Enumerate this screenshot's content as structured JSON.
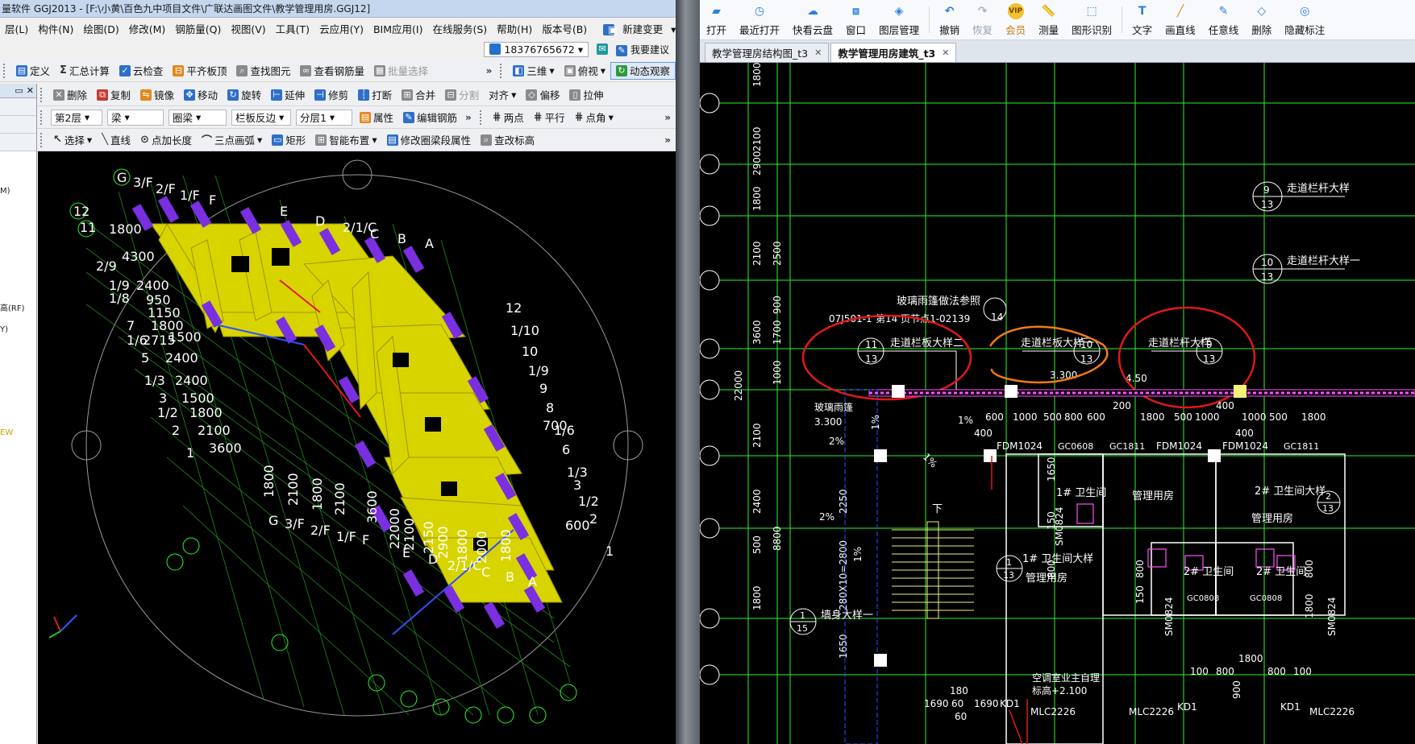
{
  "left_window": {
    "title": "量软件 GGJ2013 - [F:\\小黄\\百色九中项目文件\\广联达画图文件\\教学管理用房.GGJ12]",
    "menu": [
      "层(L)",
      "构件(N)",
      "绘图(D)",
      "修改(M)",
      "钢筋量(Q)",
      "视图(V)",
      "工具(T)",
      "云应用(Y)",
      "BIM应用(I)",
      "在线服务(S)",
      "帮助(H)",
      "版本号(B)",
      "新建变更"
    ],
    "phone": "18376765672",
    "suggest": "我要建议",
    "toolbar1": {
      "items": [
        "定义",
        "汇总计算",
        "云检查",
        "平齐板顶",
        "查找图元",
        "查看钢筋量",
        "批量选择"
      ],
      "view_items": [
        "三维",
        "俯视",
        "动态观察"
      ]
    },
    "toolbar2": [
      "删除",
      "复制",
      "镜像",
      "移动",
      "旋转",
      "延伸",
      "修剪",
      "打断",
      "合并",
      "分割",
      "对齐",
      "偏移",
      "拉伸"
    ],
    "toolbar3": {
      "floor": "第2层",
      "type": "梁",
      "subtype": "圈梁",
      "element": "栏板反边",
      "layer": "分层1",
      "attr": "属性",
      "edit_rebar": "编辑钢筋",
      "snap_items": [
        "两点",
        "平行",
        "点角"
      ]
    },
    "toolbar4": [
      "选择",
      "直线",
      "点加长度",
      "三点画弧",
      "矩形",
      "智能布置",
      "修改圈梁段属性",
      "查改标高"
    ],
    "side_labels": [
      "M)",
      "高(RF)",
      "Y)",
      "EW"
    ],
    "axis_labels_left": [
      "G",
      "3/F",
      "2/F",
      "1/F",
      "F",
      "12",
      "11",
      "1800",
      "4300",
      "2/9",
      "1/9",
      "1/8",
      "2400",
      "950",
      "1150",
      "7",
      "1800",
      "1/6",
      "2715",
      "1500",
      "5",
      "2400",
      "1/3",
      "2400",
      "3",
      "1500",
      "1/2",
      "1800",
      "2",
      "2100",
      "1",
      "3600"
    ],
    "axis_labels_top": [
      "E",
      "D",
      "2/1/C",
      "C",
      "B",
      "A"
    ],
    "axis_labels_right": [
      "12",
      "1/10",
      "10",
      "1/9",
      "9",
      "8",
      "700",
      "1/6",
      "6",
      "1/3",
      "3",
      "1/2",
      "2",
      "1",
      "600"
    ],
    "axis_labels_bottom": [
      "G",
      "3/F",
      "2/F",
      "1/F",
      "F",
      "1800",
      "2100",
      "1800",
      "2100",
      "3600",
      "22000",
      "2100",
      "2150",
      "2900",
      "1800",
      "2000",
      "1800",
      "E",
      "D",
      "2/1/C",
      "C",
      "B",
      "A"
    ]
  },
  "right_window": {
    "ribbon": [
      "打开",
      "最近打开",
      "快看云盘",
      "窗口",
      "图层管理",
      "撤销",
      "恢复",
      "会员",
      "测量",
      "图形识别",
      "文字",
      "画直线",
      "任意线",
      "删除",
      "隐藏标注"
    ],
    "vip_badge": "VIP",
    "tabs": [
      {
        "label": "教学管理房结构图_t3",
        "active": false
      },
      {
        "label": "教学管理用房建筑_t3",
        "active": true
      }
    ],
    "cad_texts": {
      "left_dims": [
        "1800",
        "2100",
        "2900",
        "1800",
        "2500",
        "2100",
        "900",
        "3600",
        "1700",
        "1000",
        "22000",
        "2100",
        "2400",
        "2250",
        "500",
        "8800",
        "1800",
        "1650",
        "280X10=2800"
      ],
      "canopy_note": "玻璃雨篷做法参照",
      "canopy_ref": "07J501-1",
      "canopy_page": "第14 页节点1-02139",
      "canopy_num": "14",
      "detail1_title": "走道栏板大样二",
      "detail1_num": "11",
      "detail1_sheet": "13",
      "detail2_title": "走道栏板大样一",
      "detail2_num": "10",
      "detail2_sheet": "13",
      "detail3_title": "走道栏杆大样",
      "detail3_num": "9",
      "detail3_sheet": "13",
      "top_detail1_title": "走道栏杆大样",
      "top_detail1_num": "9",
      "top_detail1_sheet": "13",
      "top_detail2_title": "走道栏杆大样一",
      "top_detail2_num": "10",
      "top_detail2_sheet": "13",
      "elev1": "3.300",
      "elev2": "4.50",
      "elev3": "3.300",
      "canopy": "玻璃雨篷",
      "slope1": "1%",
      "slope2": "2%",
      "slope3": "1%",
      "slope4": "2%",
      "slope5": "1%",
      "slope6": "1%",
      "dims_row": [
        "600",
        "1000",
        "500",
        "800",
        "600",
        "200",
        "1800",
        "500",
        "1000",
        "400",
        "1000",
        "500",
        "1800"
      ],
      "dims_400": [
        "400",
        "400"
      ],
      "doors": [
        "FDM1024",
        "GC0608",
        "GC1811",
        "FDM1024",
        "FDM1024",
        "GC1811"
      ],
      "room1": "1# 卫生间",
      "room2": "管理用房",
      "room3": "2# 卫生间大样",
      "room4": "管理用房",
      "room5": "1# 卫生间大样",
      "room6": "管理用房",
      "room7": "2# 卫生间",
      "room8": "2# 卫生间",
      "detail_2_13_a": "2",
      "detail_2_13_b": "13",
      "detail_1_13_a": "1",
      "detail_1_13_b": "13",
      "wall_detail": "墙身大样一",
      "wall_detail_num": "1",
      "wall_detail_sheet": "15",
      "ac_note": "空调室业主自理",
      "ac_elev": "标高+2.100",
      "stair_down": "下",
      "mlc1": "MLC2226",
      "mlc2": "MLC2226",
      "mlc3": "MLC2226",
      "kd1": "KD1",
      "kd2": "KD1",
      "kd3": "KD1",
      "sm1": "SM0824",
      "sm2": "SM0824",
      "sm3": "SM0824",
      "gc0808a": "GC0808",
      "gc0808b": "GC0808",
      "bottom_dims": [
        "180",
        "1690",
        "60",
        "1690",
        "60"
      ],
      "bath_dims": [
        "100",
        "800",
        "1800",
        "800",
        "100",
        "900",
        "800",
        "150",
        "1650",
        "800",
        "150",
        "800",
        "1800"
      ]
    }
  },
  "colors": {
    "wall_yellow": "#d8d400",
    "column_purple": "#7a2fe0",
    "grid_green": "#2cf52c",
    "cad_white": "#ffffff",
    "markup_red": "#e01818",
    "markup_orange": "#f07c14",
    "cad_pink": "#ff50ff",
    "cad_yellow": "#f5f07a"
  }
}
